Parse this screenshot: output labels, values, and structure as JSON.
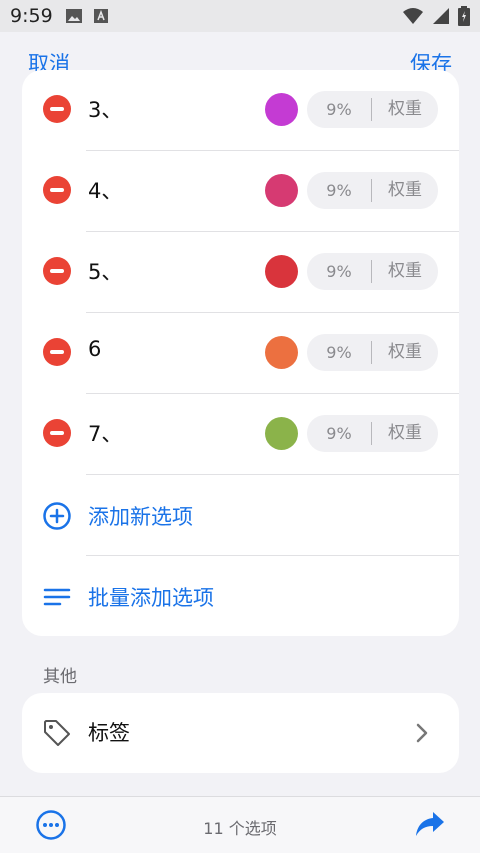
{
  "status_bar": {
    "time": "9:59"
  },
  "nav": {
    "cancel": "取消",
    "save": "保存"
  },
  "options": [
    {
      "label": "3、",
      "color": "#c43bd3",
      "weight_pct": "9%",
      "weight_label": "权重"
    },
    {
      "label": "4、",
      "color": "#d63a72",
      "weight_pct": "9%",
      "weight_label": "权重"
    },
    {
      "label": "5、",
      "color": "#d9343c",
      "weight_pct": "9%",
      "weight_label": "权重"
    },
    {
      "label": "6",
      "color": "#ec7040",
      "weight_pct": "9%",
      "weight_label": "权重"
    },
    {
      "label": "7、",
      "color": "#8bb34a",
      "weight_pct": "9%",
      "weight_label": "权重"
    }
  ],
  "actions": {
    "add_option": "添加新选项",
    "batch_add": "批量添加选项"
  },
  "other": {
    "header": "其他",
    "tags_label": "标签"
  },
  "bottom": {
    "count_text": "11 个选项"
  },
  "colors": {
    "accent": "#1a73e8",
    "remove": "#ea4335"
  },
  "icons": [
    "minus-circle-icon",
    "plus-circle-icon",
    "list-icon",
    "tag-icon",
    "chevron-right-icon",
    "more-icon",
    "share-icon"
  ]
}
